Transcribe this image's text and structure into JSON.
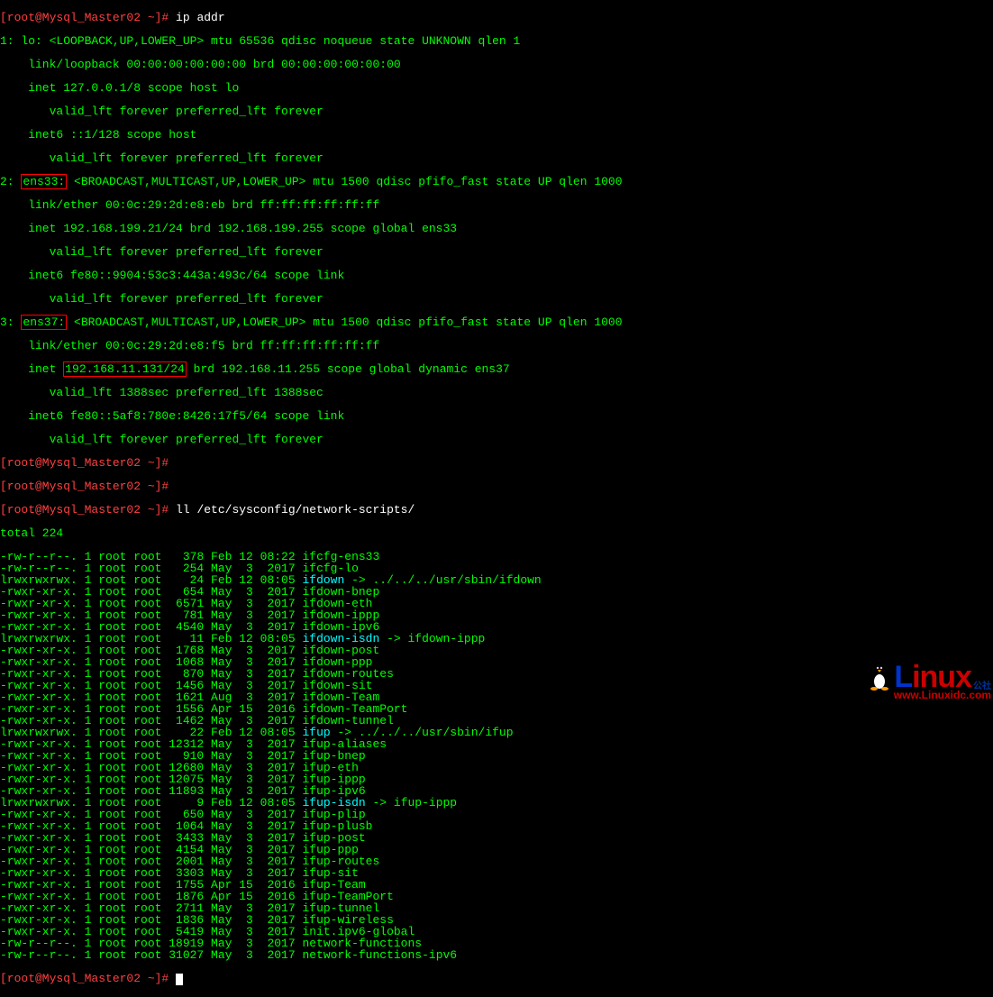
{
  "prompt": "[root@Mysql_Master02 ~]#",
  "cmd1": " ip addr",
  "cmd2": " ll /etc/sysconfig/network-scripts/",
  "ip": {
    "lo1": "1: lo: <LOOPBACK,UP,LOWER_UP> mtu 65536 qdisc noqueue state UNKNOWN qlen 1",
    "lo2": "    link/loopback 00:00:00:00:00:00 brd 00:00:00:00:00:00",
    "lo3": "    inet 127.0.0.1/8 scope host lo",
    "lo4": "       valid_lft forever preferred_lft forever",
    "lo5": "    inet6 ::1/128 scope host ",
    "lo6": "       valid_lft forever preferred_lft forever",
    "e33_pre": "2: ",
    "e33_box": "ens33:",
    "e33_post": " <BROADCAST,MULTICAST,UP,LOWER_UP> mtu 1500 qdisc pfifo_fast state UP qlen 1000",
    "e33_2": "    link/ether 00:0c:29:2d:e8:eb brd ff:ff:ff:ff:ff:ff",
    "e33_3": "    inet 192.168.199.21/24 brd 192.168.199.255 scope global ens33",
    "e33_4": "       valid_lft forever preferred_lft forever",
    "e33_5": "    inet6 fe80::9904:53c3:443a:493c/64 scope link ",
    "e33_6": "       valid_lft forever preferred_lft forever",
    "e37_pre": "3: ",
    "e37_box": "ens37:",
    "e37_post": " <BROADCAST,MULTICAST,UP,LOWER_UP> mtu 1500 qdisc pfifo_fast state UP qlen 1000",
    "e37_2": "    link/ether 00:0c:29:2d:e8:f5 brd ff:ff:ff:ff:ff:ff",
    "e37_3a": "    inet ",
    "e37_3box": "192.168.11.131/24",
    "e37_3b": " brd 192.168.11.255 scope global dynamic ens37",
    "e37_4": "       valid_lft 1388sec preferred_lft 1388sec",
    "e37_5": "    inet6 fe80::5af8:780e:8426:17f5/64 scope link ",
    "e37_6": "       valid_lft forever preferred_lft forever"
  },
  "total": "total 224",
  "rows": [
    {
      "p": "-rw-r--r--. 1 root root   378 Feb 12 08:22 ",
      "n": "ifcfg-ens33",
      "c": "green"
    },
    {
      "p": "-rw-r--r--. 1 root root   254 May  3  2017 ",
      "n": "ifcfg-lo",
      "c": "green"
    },
    {
      "p": "lrwxrwxrwx. 1 root root    24 Feb 12 08:05 ",
      "n": "ifdown",
      "c": "cyan",
      "a": " -> ../../../usr/sbin/ifdown"
    },
    {
      "p": "-rwxr-xr-x. 1 root root   654 May  3  2017 ",
      "n": "ifdown-bnep",
      "c": "green"
    },
    {
      "p": "-rwxr-xr-x. 1 root root  6571 May  3  2017 ",
      "n": "ifdown-eth",
      "c": "green"
    },
    {
      "p": "-rwxr-xr-x. 1 root root   781 May  3  2017 ",
      "n": "ifdown-ippp",
      "c": "green"
    },
    {
      "p": "-rwxr-xr-x. 1 root root  4540 May  3  2017 ",
      "n": "ifdown-ipv6",
      "c": "green"
    },
    {
      "p": "lrwxrwxrwx. 1 root root    11 Feb 12 08:05 ",
      "n": "ifdown-isdn",
      "c": "cyan",
      "a": " -> ifdown-ippp"
    },
    {
      "p": "-rwxr-xr-x. 1 root root  1768 May  3  2017 ",
      "n": "ifdown-post",
      "c": "green"
    },
    {
      "p": "-rwxr-xr-x. 1 root root  1068 May  3  2017 ",
      "n": "ifdown-ppp",
      "c": "green"
    },
    {
      "p": "-rwxr-xr-x. 1 root root   870 May  3  2017 ",
      "n": "ifdown-routes",
      "c": "green"
    },
    {
      "p": "-rwxr-xr-x. 1 root root  1456 May  3  2017 ",
      "n": "ifdown-sit",
      "c": "green"
    },
    {
      "p": "-rwxr-xr-x. 1 root root  1621 Aug  3  2017 ",
      "n": "ifdown-Team",
      "c": "green"
    },
    {
      "p": "-rwxr-xr-x. 1 root root  1556 Apr 15  2016 ",
      "n": "ifdown-TeamPort",
      "c": "green"
    },
    {
      "p": "-rwxr-xr-x. 1 root root  1462 May  3  2017 ",
      "n": "ifdown-tunnel",
      "c": "green"
    },
    {
      "p": "lrwxrwxrwx. 1 root root    22 Feb 12 08:05 ",
      "n": "ifup",
      "c": "cyan",
      "a": " -> ../../../usr/sbin/ifup"
    },
    {
      "p": "-rwxr-xr-x. 1 root root 12312 May  3  2017 ",
      "n": "ifup-aliases",
      "c": "green"
    },
    {
      "p": "-rwxr-xr-x. 1 root root   910 May  3  2017 ",
      "n": "ifup-bnep",
      "c": "green"
    },
    {
      "p": "-rwxr-xr-x. 1 root root 12680 May  3  2017 ",
      "n": "ifup-eth",
      "c": "green"
    },
    {
      "p": "-rwxr-xr-x. 1 root root 12075 May  3  2017 ",
      "n": "ifup-ippp",
      "c": "green"
    },
    {
      "p": "-rwxr-xr-x. 1 root root 11893 May  3  2017 ",
      "n": "ifup-ipv6",
      "c": "green"
    },
    {
      "p": "lrwxrwxrwx. 1 root root     9 Feb 12 08:05 ",
      "n": "ifup-isdn",
      "c": "cyan",
      "a": " -> ifup-ippp"
    },
    {
      "p": "-rwxr-xr-x. 1 root root   650 May  3  2017 ",
      "n": "ifup-plip",
      "c": "green"
    },
    {
      "p": "-rwxr-xr-x. 1 root root  1064 May  3  2017 ",
      "n": "ifup-plusb",
      "c": "green"
    },
    {
      "p": "-rwxr-xr-x. 1 root root  3433 May  3  2017 ",
      "n": "ifup-post",
      "c": "green"
    },
    {
      "p": "-rwxr-xr-x. 1 root root  4154 May  3  2017 ",
      "n": "ifup-ppp",
      "c": "green"
    },
    {
      "p": "-rwxr-xr-x. 1 root root  2001 May  3  2017 ",
      "n": "ifup-routes",
      "c": "green"
    },
    {
      "p": "-rwxr-xr-x. 1 root root  3303 May  3  2017 ",
      "n": "ifup-sit",
      "c": "green"
    },
    {
      "p": "-rwxr-xr-x. 1 root root  1755 Apr 15  2016 ",
      "n": "ifup-Team",
      "c": "green"
    },
    {
      "p": "-rwxr-xr-x. 1 root root  1876 Apr 15  2016 ",
      "n": "ifup-TeamPort",
      "c": "green"
    },
    {
      "p": "-rwxr-xr-x. 1 root root  2711 May  3  2017 ",
      "n": "ifup-tunnel",
      "c": "green"
    },
    {
      "p": "-rwxr-xr-x. 1 root root  1836 May  3  2017 ",
      "n": "ifup-wireless",
      "c": "green"
    },
    {
      "p": "-rwxr-xr-x. 1 root root  5419 May  3  2017 ",
      "n": "init.ipv6-global",
      "c": "green"
    },
    {
      "p": "-rw-r--r--. 1 root root 18919 May  3  2017 ",
      "n": "network-functions",
      "c": "green"
    },
    {
      "p": "-rw-r--r--. 1 root root 31027 May  3  2017 ",
      "n": "network-functions-ipv6",
      "c": "green"
    }
  ],
  "watermark": {
    "brand": "Linux",
    "sub": "公社",
    "url": "www.Linuxidc.com"
  }
}
